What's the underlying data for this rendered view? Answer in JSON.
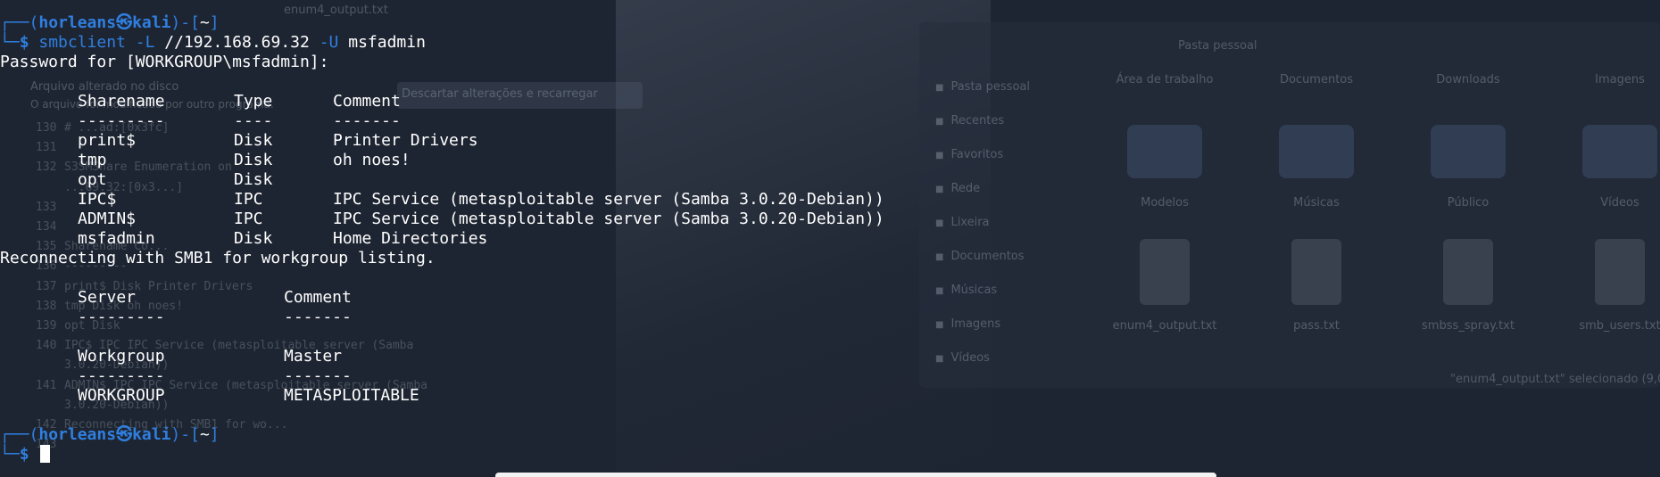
{
  "prompt": {
    "user": "horleans",
    "host": "kali",
    "cwd": "~",
    "symbol": "$"
  },
  "command": {
    "bin": "smbclient",
    "flag_list": "-L",
    "target": "//192.168.69.32",
    "flag_user": "-U",
    "user": "msfadmin"
  },
  "output": {
    "password_prompt": "Password for [WORKGROUP\\msfadmin]:",
    "share_table": {
      "headers": [
        "Sharename",
        "Type",
        "Comment"
      ],
      "separators": [
        "---------",
        "----",
        "-------"
      ],
      "rows": [
        [
          "print$",
          "Disk",
          "Printer Drivers"
        ],
        [
          "tmp",
          "Disk",
          "oh noes!"
        ],
        [
          "opt",
          "Disk",
          ""
        ],
        [
          "IPC$",
          "IPC",
          "IPC Service (metasploitable server (Samba 3.0.20-Debian))"
        ],
        [
          "ADMIN$",
          "IPC",
          "IPC Service (metasploitable server (Samba 3.0.20-Debian))"
        ],
        [
          "msfadmin",
          "Disk",
          "Home Directories"
        ]
      ]
    },
    "reconnect_msg": "Reconnecting with SMB1 for workgroup listing.",
    "server_table": {
      "headers": [
        "Server",
        "Comment"
      ],
      "separators": [
        "---------",
        "-------"
      ]
    },
    "workgroup_table": {
      "headers": [
        "Workgroup",
        "Master"
      ],
      "separators": [
        "---------",
        "-------"
      ],
      "rows": [
        [
          "WORKGROUP",
          "METASPLOITABLE"
        ]
      ]
    }
  },
  "background": {
    "editor_tab": "enum4_output.txt",
    "editor_notice_title": "Arquivo alterado no disco",
    "editor_notice_body": "O arquivo foi modificado por outro programa.",
    "editor_reload_button": "Descartar alterações e recarregar",
    "editor_lines": [
      {
        "n": "130",
        "t": "# ...ad:[0x3fc]"
      },
      {
        "n": "131",
        "t": ""
      },
      {
        "n": "132",
        "t": "          S3SMShare Enumeration on"
      },
      {
        "n": "",
        "t": "   ...69.32:[0x3...]"
      },
      {
        "n": "133",
        "t": ""
      },
      {
        "n": "134",
        "t": ""
      },
      {
        "n": "135",
        "t": "       Sharename          Co..."
      },
      {
        "n": "136",
        "t": "       ---------"
      },
      {
        "n": "137",
        "t": "       print$           Disk    Printer Drivers"
      },
      {
        "n": "138",
        "t": "       tmp              Disk    oh noes!"
      },
      {
        "n": "139",
        "t": "       opt              Disk"
      },
      {
        "n": "140",
        "t": "       IPC$             IPC     IPC Service (metasploitable server (Samba"
      },
      {
        "n": "",
        "t": "   3.0.20-Debian))"
      },
      {
        "n": "141",
        "t": "       ADMIN$           IPC     IPC Service (metasploitable server (Samba"
      },
      {
        "n": "",
        "t": "   3.0.20-Debian))"
      },
      {
        "n": "142",
        "t": "Reconnecting with SMB1 for wo..."
      },
      {
        "n": "143",
        "t": ""
      }
    ],
    "fm_header": "Pasta pessoal",
    "fm_places": [
      "Pasta pessoal",
      "Recentes",
      "Favoritos",
      "Rede",
      "Lixeira",
      "Documentos",
      "Músicas",
      "Imagens",
      "Vídeos"
    ],
    "fm_folders": [
      "Área de trabalho",
      "Documentos",
      "Downloads",
      "Imagens",
      "Modelos",
      "Músicas",
      "Público",
      "Vídeos"
    ],
    "fm_files": [
      "enum4_output.txt",
      "pass.txt",
      "smbss_spray.txt",
      "smb_users.txt"
    ],
    "fm_status": "\"enum4_output.txt\" selecionado (9,0 kB)"
  }
}
